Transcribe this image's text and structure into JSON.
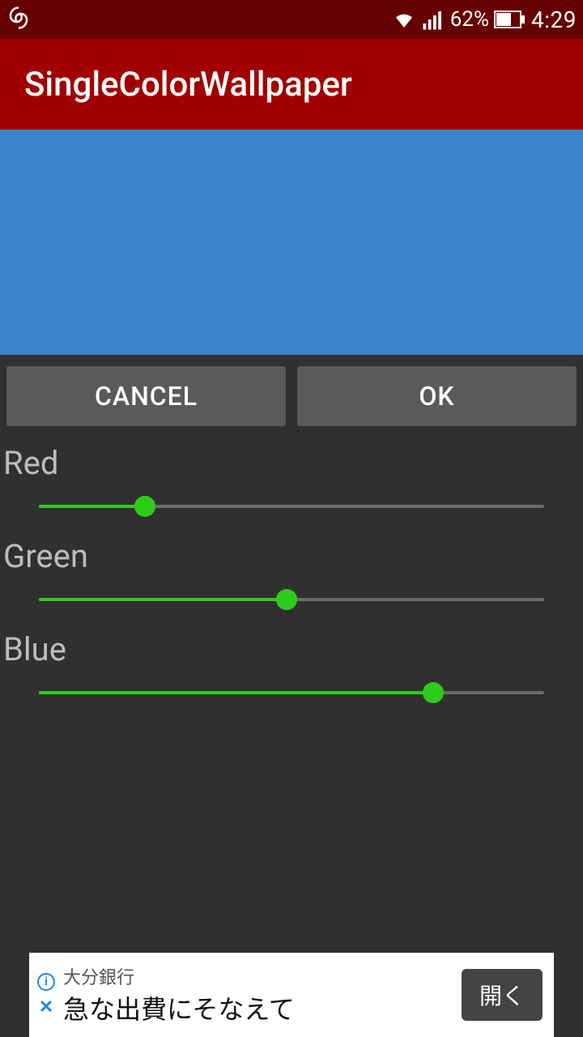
{
  "status": {
    "battery_text": "62%",
    "time": "4:29"
  },
  "app": {
    "title": "SingleColorWallpaper"
  },
  "preview": {
    "color": "#3a85c9"
  },
  "buttons": {
    "cancel": "CANCEL",
    "ok": "OK"
  },
  "sliders": {
    "red": {
      "label": "Red",
      "percent": 21
    },
    "green": {
      "label": "Green",
      "percent": 49
    },
    "blue": {
      "label": "Blue",
      "percent": 78
    }
  },
  "ad": {
    "title": "大分銀行",
    "body": "急な出費にそなえて",
    "cta": "開く"
  }
}
